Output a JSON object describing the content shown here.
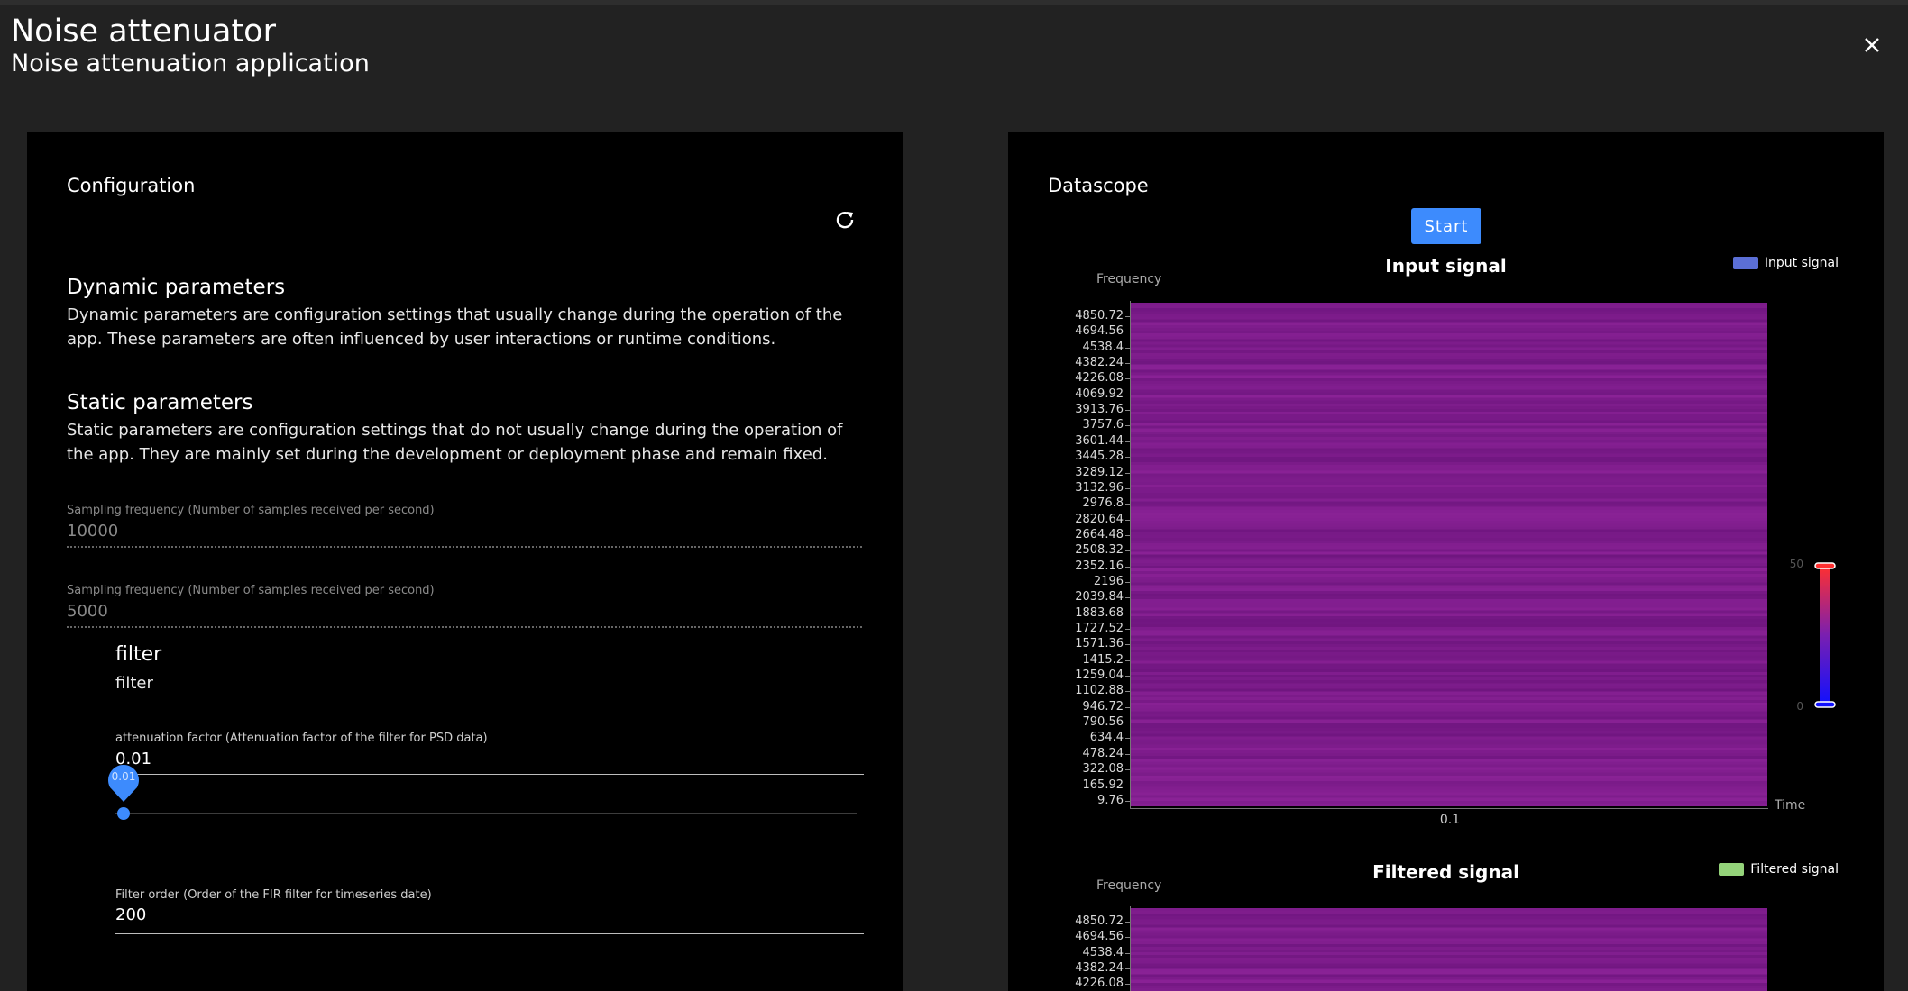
{
  "header": {
    "title": "Noise attenuator",
    "subtitle": "Noise attenuation application"
  },
  "config": {
    "title": "Configuration",
    "dynamic": {
      "heading": "Dynamic parameters",
      "text": "Dynamic parameters are configuration settings that usually change during the operation of the app. These parameters are often influenced by user interactions or runtime conditions."
    },
    "static": {
      "heading": "Static parameters",
      "text": "Static parameters are configuration settings that do not usually change during the operation of the app. They are mainly set during the development or deployment phase and remain fixed."
    },
    "fields": [
      {
        "label": "Sampling frequency (Number of samples received per second)",
        "value": "10000"
      },
      {
        "label": "Sampling frequency (Number of samples received per second)",
        "value": "5000"
      }
    ],
    "filter": {
      "title": "filter",
      "description": "filter",
      "attenuation": {
        "label": "attenuation factor (Attenuation factor of the filter for PSD data)",
        "value": "0.01",
        "bubble": "0.01",
        "fraction": 0
      },
      "order": {
        "label": "Filter order (Order of the FIR filter for timeseries date)",
        "value": "200"
      }
    }
  },
  "datascope": {
    "title": "Datascope",
    "start_label": "Start",
    "colors": {
      "accent": "#3d8bfd",
      "heat_base": "#7c1d8a",
      "input_legend": "#5b6fd6",
      "filtered_legend": "#94d37a"
    }
  },
  "chart_data": [
    {
      "type": "heatmap",
      "title": "Input signal",
      "legend": "Input signal",
      "legend_placement": "top-right",
      "ylabel": "Frequency",
      "xlabel": "Time",
      "x_ticks": [
        "0.1"
      ],
      "y_ticks": [
        "4850.72",
        "4694.56",
        "4538.4",
        "4382.24",
        "4226.08",
        "4069.92",
        "3913.76",
        "3757.6",
        "3601.44",
        "3445.28",
        "3289.12",
        "3132.96",
        "2976.8",
        "2820.64",
        "2664.48",
        "2508.32",
        "2352.16",
        "2196",
        "2039.84",
        "1883.68",
        "1727.52",
        "1571.36",
        "1415.2",
        "1259.04",
        "1102.88",
        "946.72",
        "790.56",
        "634.4",
        "478.24",
        "322.08",
        "165.92",
        "9.76"
      ],
      "colorbar": {
        "min": 0,
        "max": 50,
        "labels": [
          "50",
          "0"
        ]
      }
    },
    {
      "type": "heatmap",
      "title": "Filtered signal",
      "legend": "Filtered signal",
      "legend_placement": "top-right",
      "ylabel": "Frequency",
      "y_ticks_visible": [
        "4850.72",
        "4694.56",
        "4538.4",
        "4382.24",
        "4226.08"
      ]
    }
  ]
}
